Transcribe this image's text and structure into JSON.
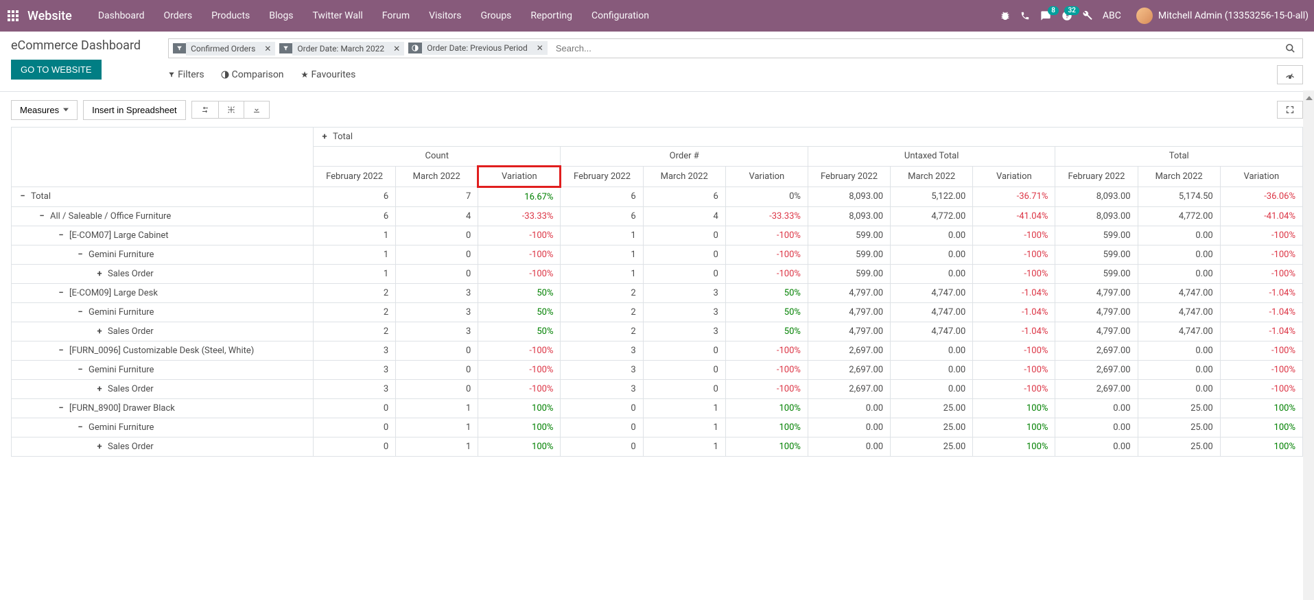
{
  "navbar": {
    "brand": "Website",
    "menu": [
      "Dashboard",
      "Orders",
      "Products",
      "Blogs",
      "Twitter Wall",
      "Forum",
      "Visitors",
      "Groups",
      "Reporting",
      "Configuration"
    ],
    "badge_messages": "8",
    "badge_activities": "32",
    "abc": "ABC",
    "user": "Mitchell Admin (13353256-15-0-all)"
  },
  "page": {
    "title": "eCommerce Dashboard",
    "go_to_website": "GO TO WEBSITE"
  },
  "search": {
    "facets": [
      {
        "label": "Confirmed Orders"
      },
      {
        "label": "Order Date: March 2022"
      },
      {
        "label": "Order Date: Previous Period"
      }
    ],
    "placeholder": "Search...",
    "filters": "Filters",
    "comparison": "Comparison",
    "favourites": "Favourites"
  },
  "toolbar": {
    "measures": "Measures",
    "insert": "Insert in Spreadsheet"
  },
  "pivot": {
    "top_total": "Total",
    "measure_headers": [
      "Count",
      "Order #",
      "Untaxed Total",
      "Total"
    ],
    "period_headers": [
      "February 2022",
      "March 2022",
      "Variation"
    ],
    "rows": [
      {
        "label": "Total",
        "indent": 0,
        "toggle": "−",
        "cells": [
          "6",
          "7",
          "16.67%",
          "6",
          "6",
          "0%",
          "8,093.00",
          "5,122.00",
          "-36.71%",
          "8,093.00",
          "5,174.50",
          "-36.06%"
        ],
        "signs": [
          0,
          0,
          1,
          0,
          0,
          0,
          0,
          0,
          -1,
          0,
          0,
          -1
        ]
      },
      {
        "label": "All / Saleable / Office Furniture",
        "indent": 1,
        "toggle": "−",
        "cells": [
          "6",
          "4",
          "-33.33%",
          "6",
          "4",
          "-33.33%",
          "8,093.00",
          "4,772.00",
          "-41.04%",
          "8,093.00",
          "4,772.00",
          "-41.04%"
        ],
        "signs": [
          0,
          0,
          -1,
          0,
          0,
          -1,
          0,
          0,
          -1,
          0,
          0,
          -1
        ]
      },
      {
        "label": "[E-COM07] Large Cabinet",
        "indent": 2,
        "toggle": "−",
        "cells": [
          "1",
          "0",
          "-100%",
          "1",
          "0",
          "-100%",
          "599.00",
          "0.00",
          "-100%",
          "599.00",
          "0.00",
          "-100%"
        ],
        "signs": [
          0,
          0,
          -1,
          0,
          0,
          -1,
          0,
          0,
          -1,
          0,
          0,
          -1
        ]
      },
      {
        "label": "Gemini Furniture",
        "indent": 3,
        "toggle": "−",
        "cells": [
          "1",
          "0",
          "-100%",
          "1",
          "0",
          "-100%",
          "599.00",
          "0.00",
          "-100%",
          "599.00",
          "0.00",
          "-100%"
        ],
        "signs": [
          0,
          0,
          -1,
          0,
          0,
          -1,
          0,
          0,
          -1,
          0,
          0,
          -1
        ]
      },
      {
        "label": "Sales Order",
        "indent": 4,
        "toggle": "+",
        "cells": [
          "1",
          "0",
          "-100%",
          "1",
          "0",
          "-100%",
          "599.00",
          "0.00",
          "-100%",
          "599.00",
          "0.00",
          "-100%"
        ],
        "signs": [
          0,
          0,
          -1,
          0,
          0,
          -1,
          0,
          0,
          -1,
          0,
          0,
          -1
        ]
      },
      {
        "label": "[E-COM09] Large Desk",
        "indent": 2,
        "toggle": "−",
        "cells": [
          "2",
          "3",
          "50%",
          "2",
          "3",
          "50%",
          "4,797.00",
          "4,747.00",
          "-1.04%",
          "4,797.00",
          "4,747.00",
          "-1.04%"
        ],
        "signs": [
          0,
          0,
          1,
          0,
          0,
          1,
          0,
          0,
          -1,
          0,
          0,
          -1
        ]
      },
      {
        "label": "Gemini Furniture",
        "indent": 3,
        "toggle": "−",
        "cells": [
          "2",
          "3",
          "50%",
          "2",
          "3",
          "50%",
          "4,797.00",
          "4,747.00",
          "-1.04%",
          "4,797.00",
          "4,747.00",
          "-1.04%"
        ],
        "signs": [
          0,
          0,
          1,
          0,
          0,
          1,
          0,
          0,
          -1,
          0,
          0,
          -1
        ]
      },
      {
        "label": "Sales Order",
        "indent": 4,
        "toggle": "+",
        "cells": [
          "2",
          "3",
          "50%",
          "2",
          "3",
          "50%",
          "4,797.00",
          "4,747.00",
          "-1.04%",
          "4,797.00",
          "4,747.00",
          "-1.04%"
        ],
        "signs": [
          0,
          0,
          1,
          0,
          0,
          1,
          0,
          0,
          -1,
          0,
          0,
          -1
        ]
      },
      {
        "label": "[FURN_0096] Customizable Desk (Steel, White)",
        "indent": 2,
        "toggle": "−",
        "cells": [
          "3",
          "0",
          "-100%",
          "3",
          "0",
          "-100%",
          "2,697.00",
          "0.00",
          "-100%",
          "2,697.00",
          "0.00",
          "-100%"
        ],
        "signs": [
          0,
          0,
          -1,
          0,
          0,
          -1,
          0,
          0,
          -1,
          0,
          0,
          -1
        ]
      },
      {
        "label": "Gemini Furniture",
        "indent": 3,
        "toggle": "−",
        "cells": [
          "3",
          "0",
          "-100%",
          "3",
          "0",
          "-100%",
          "2,697.00",
          "0.00",
          "-100%",
          "2,697.00",
          "0.00",
          "-100%"
        ],
        "signs": [
          0,
          0,
          -1,
          0,
          0,
          -1,
          0,
          0,
          -1,
          0,
          0,
          -1
        ]
      },
      {
        "label": "Sales Order",
        "indent": 4,
        "toggle": "+",
        "cells": [
          "3",
          "0",
          "-100%",
          "3",
          "0",
          "-100%",
          "2,697.00",
          "0.00",
          "-100%",
          "2,697.00",
          "0.00",
          "-100%"
        ],
        "signs": [
          0,
          0,
          -1,
          0,
          0,
          -1,
          0,
          0,
          -1,
          0,
          0,
          -1
        ]
      },
      {
        "label": "[FURN_8900] Drawer Black",
        "indent": 2,
        "toggle": "−",
        "cells": [
          "0",
          "1",
          "100%",
          "0",
          "1",
          "100%",
          "0.00",
          "25.00",
          "100%",
          "0.00",
          "25.00",
          "100%"
        ],
        "signs": [
          0,
          0,
          1,
          0,
          0,
          1,
          0,
          0,
          1,
          0,
          0,
          1
        ]
      },
      {
        "label": "Gemini Furniture",
        "indent": 3,
        "toggle": "−",
        "cells": [
          "0",
          "1",
          "100%",
          "0",
          "1",
          "100%",
          "0.00",
          "25.00",
          "100%",
          "0.00",
          "25.00",
          "100%"
        ],
        "signs": [
          0,
          0,
          1,
          0,
          0,
          1,
          0,
          0,
          1,
          0,
          0,
          1
        ]
      },
      {
        "label": "Sales Order",
        "indent": 4,
        "toggle": "+",
        "cells": [
          "0",
          "1",
          "100%",
          "0",
          "1",
          "100%",
          "0.00",
          "25.00",
          "100%",
          "0.00",
          "25.00",
          "100%"
        ],
        "signs": [
          0,
          0,
          1,
          0,
          0,
          1,
          0,
          0,
          1,
          0,
          0,
          1
        ]
      }
    ]
  }
}
